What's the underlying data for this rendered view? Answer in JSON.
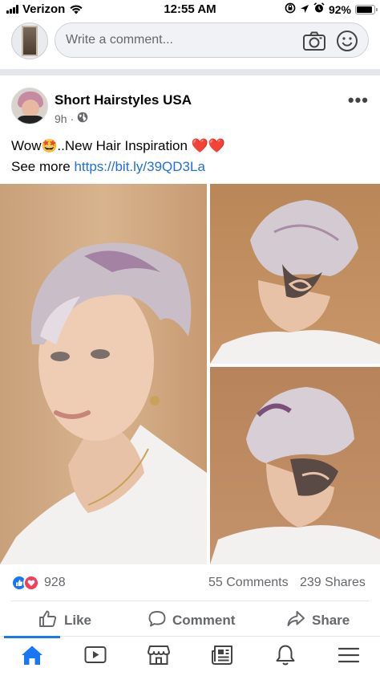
{
  "status_bar": {
    "carrier": "Verizon",
    "time": "12:55 AM",
    "battery_percent": "92%",
    "battery_level": 0.92,
    "icons": [
      "signal-icon",
      "wifi-icon",
      "screen-lock-icon",
      "location-icon",
      "alarm-icon",
      "battery-icon"
    ]
  },
  "comment_bar": {
    "placeholder": "Write a comment...",
    "icons": [
      "camera-icon",
      "smile-icon"
    ]
  },
  "post": {
    "page_name": "Short Hairstyles USA",
    "time": "9h",
    "separator": "·",
    "text_prefix": "Wow",
    "emoji_star": "🤩",
    "text_main": "..New Hair Inspiration",
    "hearts": "❤️❤️",
    "see_more": "See more",
    "link": "https://bit.ly/39QD3La"
  },
  "reactions": {
    "count": "928",
    "comments": "55 Comments",
    "shares": "239 Shares"
  },
  "actions": {
    "like": "Like",
    "comment": "Comment",
    "share": "Share"
  },
  "bottom_nav": {
    "items": [
      "home-icon",
      "watch-icon",
      "marketplace-icon",
      "news-icon",
      "notifications-icon",
      "menu-icon"
    ],
    "active": "home-icon"
  },
  "colors": {
    "brand_blue": "#1877f2",
    "link_blue": "#216fdb",
    "love_red": "#f33e58",
    "secondary_text": "#65676b"
  }
}
